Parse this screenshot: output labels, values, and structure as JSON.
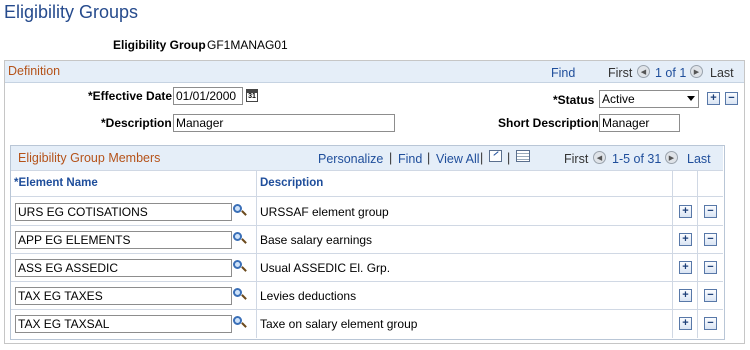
{
  "page": {
    "title": "Eligibility Groups"
  },
  "header": {
    "group_label": "Eligibility Group",
    "group_value": "GF1MANAG01"
  },
  "definition": {
    "section_title": "Definition",
    "find": "Find",
    "first": "First",
    "count": "1 of 1",
    "last": "Last",
    "effective_date_label": "*Effective Date",
    "effective_date_value": "01/01/2000",
    "status_label": "*Status",
    "status_value": "Active",
    "description_label": "*Description",
    "description_value": "Manager",
    "short_description_label": "Short Description",
    "short_description_value": "Manager"
  },
  "members": {
    "section_title": "Eligibility Group Members",
    "personalize": "Personalize",
    "find": "Find",
    "view_all": "View All",
    "first": "First",
    "count": "1-5 of 31",
    "last": "Last",
    "col_element": "*Element Name",
    "col_description": "Description",
    "rows": [
      {
        "element": "URS EG COTISATIONS",
        "description": "URSSAF element group"
      },
      {
        "element": "APP EG ELEMENTS",
        "description": "Base salary earnings"
      },
      {
        "element": "ASS EG ASSEDIC",
        "description": "Usual ASSEDIC El. Grp."
      },
      {
        "element": "TAX EG TAXES",
        "description": "Levies deductions"
      },
      {
        "element": "TAX EG TAXSAL",
        "description": "Taxe on salary element group"
      }
    ]
  },
  "icons": {
    "add": "+",
    "remove": "−",
    "prev": "◀",
    "next": "▶",
    "separator": "|"
  }
}
